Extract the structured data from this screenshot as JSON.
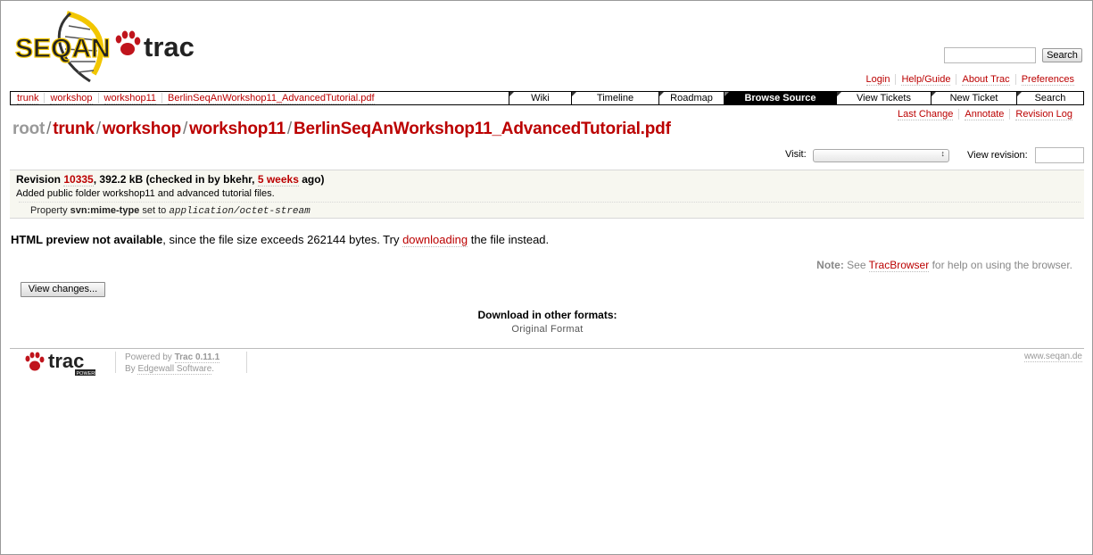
{
  "logo": {
    "text_left": "SEQAN",
    "text_right": "trac"
  },
  "search": {
    "button_label": "Search",
    "value": ""
  },
  "metanav": [
    "Login",
    "Help/Guide",
    "About Trac",
    "Preferences"
  ],
  "breadcrumb": [
    "trunk",
    "workshop",
    "workshop11",
    "BerlinSeqAnWorkshop11_AdvancedTutorial.pdf"
  ],
  "mainnav": [
    {
      "label": "Wiki",
      "active": false
    },
    {
      "label": "Timeline",
      "active": false
    },
    {
      "label": "Roadmap",
      "active": false
    },
    {
      "label": "Browse Source",
      "active": true
    },
    {
      "label": "View Tickets",
      "active": false
    },
    {
      "label": "New Ticket",
      "active": false
    },
    {
      "label": "Search",
      "active": false
    }
  ],
  "ctxtnav": [
    "Last Change",
    "Annotate",
    "Revision Log"
  ],
  "pagepath": {
    "root": "root",
    "separator": "/",
    "segments": [
      "trunk",
      "workshop",
      "workshop11",
      "BerlinSeqAnWorkshop11_AdvancedTutorial.pdf"
    ]
  },
  "visit": {
    "label": "Visit:",
    "selected": ""
  },
  "view_revision": {
    "label": "View revision:",
    "value": ""
  },
  "info": {
    "revision_prefix": "Revision ",
    "revision": "10335",
    "size_text": ", 392.2 kB (checked in by bkehr, ",
    "age": "5 weeks",
    "age_suffix": " ago)",
    "message": "Added public folder workshop11 and advanced tutorial files.",
    "property_prefix": "Property ",
    "property_name": "svn:mime-type",
    "property_mid": " set to ",
    "property_value": "application/octet-stream"
  },
  "preview": {
    "bold": "HTML preview not available",
    "text": ", since the file size exceeds 262144 bytes. Try ",
    "link": "downloading",
    "suffix": " the file instead."
  },
  "note": {
    "label": "Note:",
    "prefix": " See ",
    "link": "TracBrowser",
    "suffix": " for help on using the browser."
  },
  "view_changes_label": "View changes...",
  "download": {
    "title": "Download in other formats:",
    "item": "Original Format"
  },
  "footer": {
    "powered_prefix": "Powered by ",
    "trac_version": "Trac 0.11.1",
    "by_prefix": "By ",
    "by_link": "Edgewall Software",
    "by_suffix": ".",
    "site": "www.seqan.de",
    "logo_text": "trac",
    "logo_badge": "POWERED"
  },
  "colors": {
    "link": "#bb0000",
    "nav_active_bg": "#000000",
    "info_bg": "#f7f7f0"
  }
}
